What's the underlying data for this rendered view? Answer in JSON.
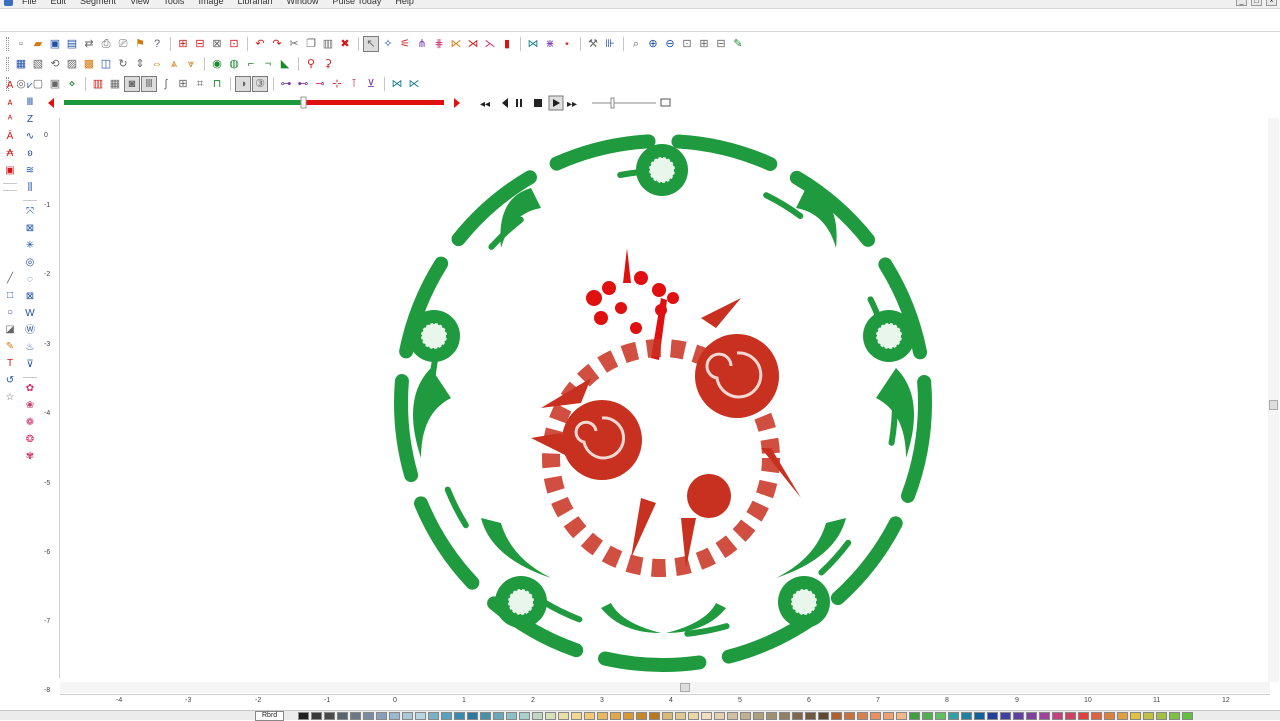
{
  "menu": [
    "File",
    "Edit",
    "Segment",
    "View",
    "Tools",
    "Image",
    "Librarian",
    "Window",
    "Pulse Today",
    "Help"
  ],
  "window_controls": [
    "_",
    "□",
    "×"
  ],
  "playback": {
    "progress": 0.92,
    "position": 0.63,
    "speed": 0.35
  },
  "vertical_ruler": [
    "0",
    "-1",
    "-2",
    "-3",
    "-4",
    "-5",
    "-6",
    "-7",
    "-8"
  ],
  "horizontal_ruler": [
    "-4",
    "-3",
    "-2",
    "-1",
    "0",
    "1",
    "2",
    "3",
    "4",
    "5",
    "6",
    "7",
    "8",
    "9",
    "10",
    "11",
    "12"
  ],
  "thread_palette": {
    "selected_label": "Rbrd",
    "swatches": [
      "#202020",
      "#383838",
      "#4a4a4a",
      "#5a6470",
      "#6a7888",
      "#7a8aa0",
      "#8aa0b8",
      "#9ab8d0",
      "#a8c8d8",
      "#b8d4e0",
      "#7ab0c8",
      "#5aa0c0",
      "#3a8ab0",
      "#2a7aa0",
      "#4a90a8",
      "#6aa8b8",
      "#8ac0c8",
      "#a8d0c8",
      "#c0d8c0",
      "#d8e0b8",
      "#e8e0a8",
      "#f0d890",
      "#f0c878",
      "#e8b860",
      "#e0a848",
      "#d89838",
      "#c88828",
      "#b87820",
      "#d8b878",
      "#e0c890",
      "#e8d8a8",
      "#f0e0c0",
      "#e0d0b0",
      "#d0c0a0",
      "#c0b090",
      "#b0a080",
      "#a09070",
      "#908060",
      "#806850",
      "#705840",
      "#604830",
      "#b06030",
      "#c87040",
      "#d88050",
      "#e89060",
      "#f0a070",
      "#f0b888",
      "#40a040",
      "#50b050",
      "#60c060",
      "#30a0a0",
      "#2080a0",
      "#1060a0",
      "#2040a0",
      "#4040a0",
      "#6040a0",
      "#8040a0",
      "#a040a0",
      "#c04080",
      "#d04060",
      "#e04040",
      "#e06040",
      "#e08040",
      "#e0a040",
      "#e0c040",
      "#c0c040",
      "#a0c040",
      "#80c040",
      "#60c040"
    ]
  },
  "colors": {
    "outline_green": "#1f9a3f",
    "accent_red": "#e01010",
    "rose_red": "#c83020",
    "leaf_green": "#2aa84a",
    "play_green": "#1a9a3a",
    "play_red": "#e01010"
  }
}
